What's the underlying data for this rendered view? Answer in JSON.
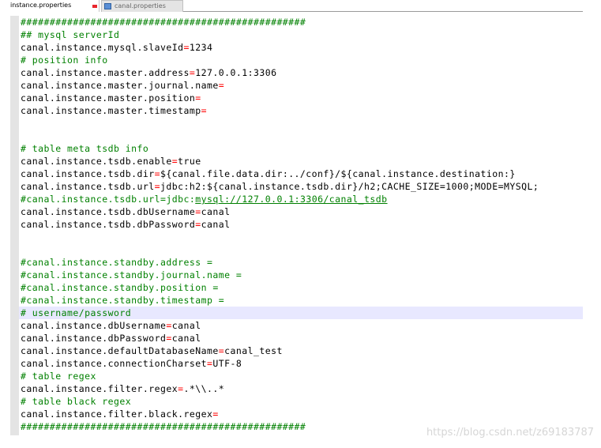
{
  "tabs": [
    {
      "label": "instance.properties",
      "active": true
    },
    {
      "label": "canal.properties",
      "active": false
    }
  ],
  "editor": {
    "lines": [
      {
        "type": "comment",
        "text": "#################################################"
      },
      {
        "type": "comment",
        "text": "## mysql serverId"
      },
      {
        "type": "kv",
        "key": "canal.instance.mysql.slaveId",
        "value": "1234"
      },
      {
        "type": "comment",
        "text": "# position info"
      },
      {
        "type": "kv",
        "key": "canal.instance.master.address",
        "value": "127.0.0.1:3306"
      },
      {
        "type": "kv",
        "key": "canal.instance.master.journal.name",
        "value": ""
      },
      {
        "type": "kv",
        "key": "canal.instance.master.position",
        "value": ""
      },
      {
        "type": "kv",
        "key": "canal.instance.master.timestamp",
        "value": ""
      },
      {
        "type": "blank"
      },
      {
        "type": "blank"
      },
      {
        "type": "comment",
        "text": "# table meta tsdb info"
      },
      {
        "type": "kv",
        "key": "canal.instance.tsdb.enable",
        "value": "true"
      },
      {
        "type": "kv",
        "key": "canal.instance.tsdb.dir",
        "value": "${canal.file.data.dir:../conf}/${canal.instance.destination:}"
      },
      {
        "type": "kv",
        "key": "canal.instance.tsdb.url",
        "value": "jdbc:h2:${canal.instance.tsdb.dir}/h2;CACHE_SIZE=1000;MODE=MYSQL;"
      },
      {
        "type": "comment-link",
        "text": "#canal.instance.tsdb.url=jdbc:",
        "link": "mysql://127.0.0.1:3306/canal_tsdb"
      },
      {
        "type": "kv",
        "key": "canal.instance.tsdb.dbUsername",
        "value": "canal"
      },
      {
        "type": "kv",
        "key": "canal.instance.tsdb.dbPassword",
        "value": "canal"
      },
      {
        "type": "blank"
      },
      {
        "type": "blank"
      },
      {
        "type": "comment",
        "text": "#canal.instance.standby.address ="
      },
      {
        "type": "comment",
        "text": "#canal.instance.standby.journal.name ="
      },
      {
        "type": "comment",
        "text": "#canal.instance.standby.position ="
      },
      {
        "type": "comment",
        "text": "#canal.instance.standby.timestamp ="
      },
      {
        "type": "comment",
        "text": "# username/password",
        "current": true
      },
      {
        "type": "kv",
        "key": "canal.instance.dbUsername",
        "value": "canal"
      },
      {
        "type": "kv",
        "key": "canal.instance.dbPassword",
        "value": "canal"
      },
      {
        "type": "kv",
        "key": "canal.instance.defaultDatabaseName",
        "value": "canal_test"
      },
      {
        "type": "kv",
        "key": "canal.instance.connectionCharset",
        "value": "UTF-8"
      },
      {
        "type": "comment",
        "text": "# table regex"
      },
      {
        "type": "kv",
        "key": "canal.instance.filter.regex",
        "value": ".*\\\\..*"
      },
      {
        "type": "comment",
        "text": "# table black regex"
      },
      {
        "type": "kv",
        "key": "canal.instance.filter.black.regex",
        "value": ""
      },
      {
        "type": "comment",
        "text": "#################################################"
      }
    ]
  },
  "watermark": "https://blog.csdn.net/z69183787",
  "colors": {
    "comment": "#008000",
    "operator": "#ff0000",
    "text": "#000000",
    "current_line": "#e8e8ff",
    "gutter": "#e4e4e4"
  }
}
